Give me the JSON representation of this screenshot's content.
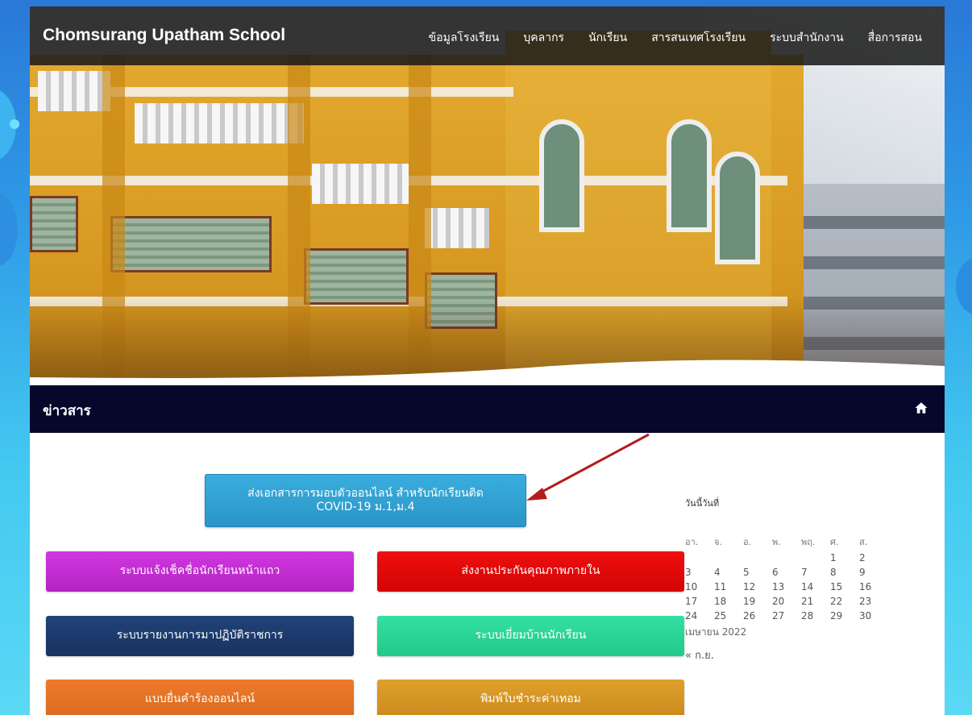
{
  "header": {
    "brand": "Chomsurang Upatham School",
    "nav": [
      "ข้อมูลโรงเรียน",
      "บุคลากร",
      "นักเรียน",
      "สารสนเทศโรงเรียน",
      "ระบบสำนักงาน",
      "สื่อการสอน"
    ]
  },
  "page_title": {
    "label": "ข่าวสาร",
    "home_icon": "home-icon"
  },
  "buttons": {
    "main": "ส่งเอกสารการมอบตัวออนไลน์ สำหรับนักเรียนติด COVID-19 ม.1,ม.4",
    "grid": [
      "ระบบแจ้งเช็คชื่อนักเรียนหน้าแถว",
      "ส่งงานประกันคุณภาพภายใน",
      "ระบบรายงานการมาปฏิบัติราชการ",
      "ระบบเยี่ยมบ้านนักเรียน",
      "แบบยื่นคำร้องออนไลน์",
      "พิมพ์ใบชำระค่าเทอม"
    ],
    "colors": [
      "#c52ed2",
      "#e80909",
      "#1c3b6d",
      "#2bd597",
      "#e37224",
      "#d69524"
    ]
  },
  "calendar": {
    "caption": "วันนี้วันที่",
    "weekdays": [
      "อา.",
      "จ.",
      "อ.",
      "พ.",
      "พฤ.",
      "ศ.",
      "ส."
    ],
    "weeks": [
      [
        "",
        "",
        "",
        "",
        "",
        "1",
        "2"
      ],
      [
        "3",
        "4",
        "5",
        "6",
        "7",
        "8",
        "9"
      ],
      [
        "10",
        "11",
        "12",
        "13",
        "14",
        "15",
        "16"
      ],
      [
        "17",
        "18",
        "19",
        "20",
        "21",
        "22",
        "23"
      ],
      [
        "24",
        "25",
        "26",
        "27",
        "28",
        "29",
        "30"
      ]
    ],
    "month": "เมษายน 2022",
    "prev": "« ก.ย."
  },
  "colors": {
    "topbar": "#191919",
    "titlebar": "#05082b",
    "annotation_arrow": "#b31d1d"
  }
}
